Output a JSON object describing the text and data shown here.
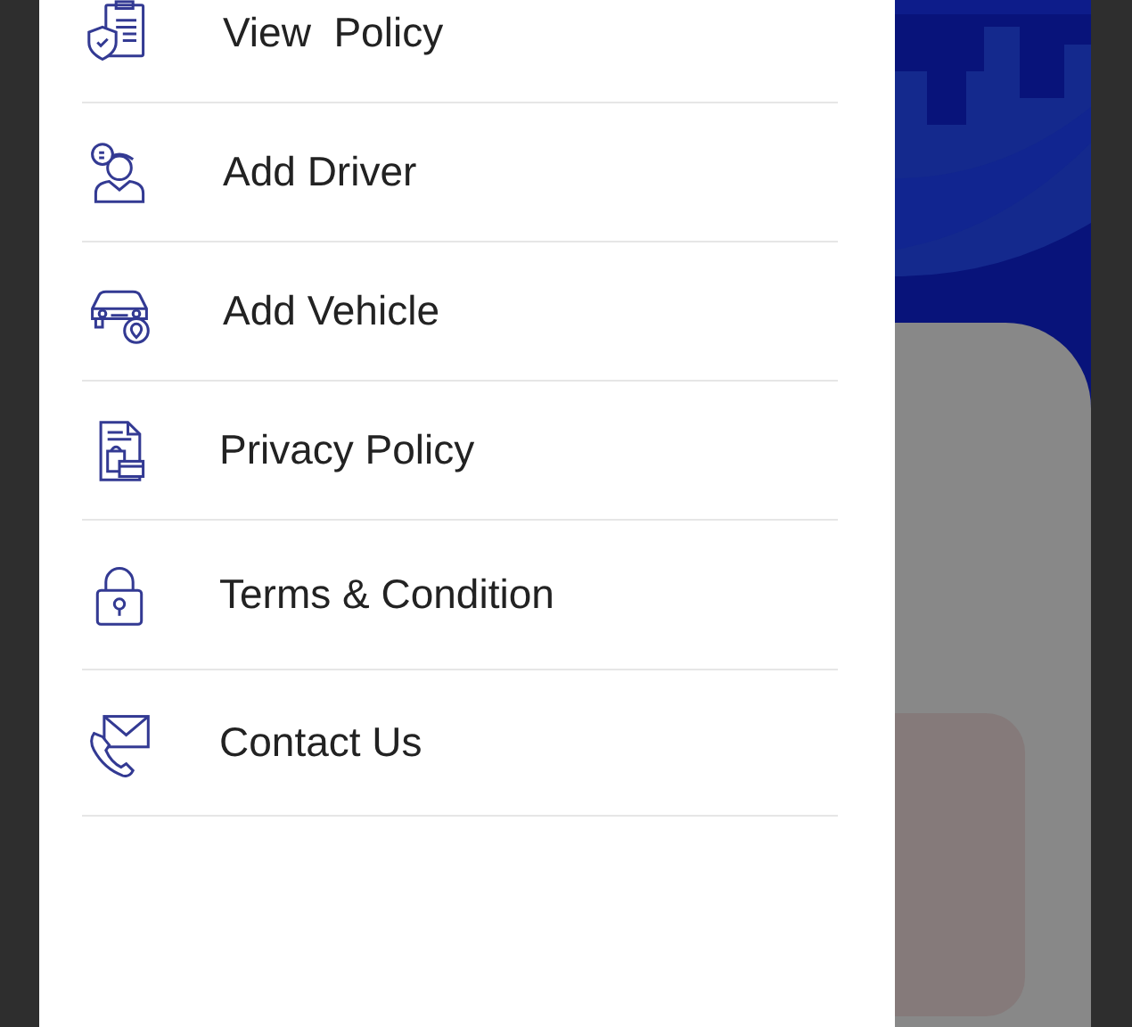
{
  "drawer": {
    "items": [
      {
        "label": "View  Policy"
      },
      {
        "label": "Add Driver"
      },
      {
        "label": "Add Vehicle"
      },
      {
        "label": "Privacy Policy"
      },
      {
        "label": "Terms & Condition"
      },
      {
        "label": "Contact Us"
      }
    ]
  }
}
